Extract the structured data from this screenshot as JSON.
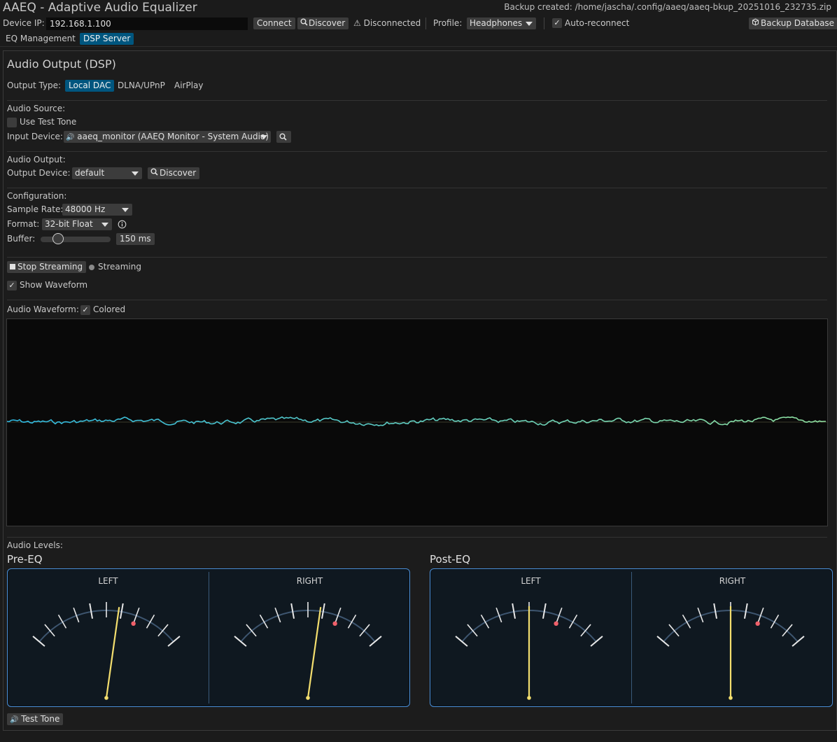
{
  "window": {
    "title": "AAEQ - Adaptive Audio Equalizer",
    "backup_text": "Backup created: /home/jascha/.config/aaeq/aaeq-bkup_20251016_232735.zip"
  },
  "toolbar": {
    "device_ip_label": "Device IP:",
    "device_ip_value": "192.168.1.100",
    "connect_label": "Connect",
    "discover_label": "Discover",
    "status_text": "Disconnected",
    "profile_label": "Profile:",
    "profile_value": "Headphones",
    "auto_reconnect_label": "Auto-reconnect",
    "auto_reconnect_checked": true,
    "backup_button_label": "Backup Database"
  },
  "tabs": [
    {
      "label": "EQ Management",
      "active": false
    },
    {
      "label": "DSP Server",
      "active": true
    }
  ],
  "main": {
    "heading": "Audio Output (DSP)",
    "output_type_label": "Output Type:",
    "output_types": [
      {
        "label": "Local DAC",
        "active": true
      },
      {
        "label": "DLNA/UPnP",
        "active": false
      },
      {
        "label": "AirPlay",
        "active": false
      }
    ],
    "audio_source": {
      "section_label": "Audio Source:",
      "test_tone_label": "Use Test Tone",
      "test_tone_checked": false,
      "input_device_label": "Input Device:",
      "input_device_value": "aaeq_monitor (AAEQ Monitor - System Audio)"
    },
    "audio_output": {
      "section_label": "Audio Output:",
      "output_device_label": "Output Device:",
      "output_device_value": "default",
      "discover_label": "Discover"
    },
    "configuration": {
      "section_label": "Configuration:",
      "sample_rate_label": "Sample Rate:",
      "sample_rate_value": "48000 Hz",
      "format_label": "Format:",
      "format_value": "32-bit Float",
      "buffer_label": "Buffer:",
      "buffer_value": "150 ms",
      "buffer_slider_fraction": 0.25
    },
    "streaming": {
      "stop_label": "Stop Streaming",
      "status_label": "Streaming",
      "show_waveform_label": "Show Waveform",
      "show_waveform_checked": true
    },
    "waveform": {
      "label": "Audio Waveform:",
      "colored_label": "Colored",
      "colored_checked": true,
      "start_color": "#2fb8e0",
      "end_color": "#8fe0a0"
    },
    "levels": {
      "section_label": "Audio Levels:",
      "groups": [
        {
          "title": "Pre-EQ",
          "meters": [
            {
              "label": "LEFT",
              "needle_fraction": 0.58
            },
            {
              "label": "RIGHT",
              "needle_fraction": 0.58
            }
          ]
        },
        {
          "title": "Post-EQ",
          "meters": [
            {
              "label": "LEFT",
              "needle_fraction": 0.5
            },
            {
              "label": "RIGHT",
              "needle_fraction": 0.5
            }
          ]
        }
      ],
      "needle_color": "#f3de6e",
      "peak_color": "#f0606a",
      "frame_color": "#4a8fd8"
    },
    "test_tone_button_label": "Test Tone"
  }
}
